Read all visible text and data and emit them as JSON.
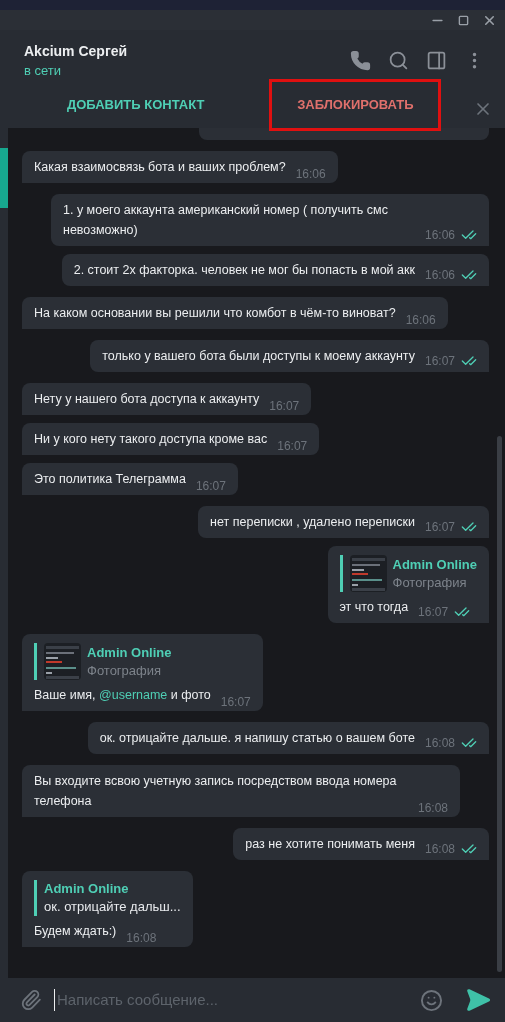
{
  "window": {
    "controls": [
      {
        "kind": "minimize"
      },
      {
        "kind": "maximize"
      },
      {
        "kind": "close"
      }
    ]
  },
  "header": {
    "name": "Akcium Сергей",
    "status": "в сети",
    "icons": [
      {
        "kind": "phone"
      },
      {
        "kind": "search"
      },
      {
        "kind": "sidebar"
      },
      {
        "kind": "menu"
      }
    ]
  },
  "action_bar": {
    "buttons": [
      {
        "label": "ДОБАВИТЬ КОНТАКТ",
        "kind": "add",
        "highlighted": false
      },
      {
        "label": "ЗАБЛОКИРОВАТЬ",
        "kind": "block",
        "highlighted": true
      }
    ]
  },
  "messages": [
    {
      "out": false,
      "kind": "text",
      "text": "Какая взаимосвязь бота и ваших проблем?",
      "time": "16:06"
    },
    {
      "out": true,
      "kind": "text",
      "text": "1. у моего аккаунта американский номер ( получить смс невозможно)",
      "time": "16:06",
      "read": true
    },
    {
      "out": true,
      "kind": "text",
      "text": "2. стоит 2х факторка. человек не мог бы попасть в мой акк",
      "time": "16:06",
      "read": true
    },
    {
      "out": false,
      "kind": "text",
      "text": "На каком основании вы решили что комбот в чём-то виноват?",
      "time": "16:06"
    },
    {
      "out": true,
      "kind": "text",
      "text": "только у вашего бота были доступы  к моему аккаунту",
      "time": "16:07",
      "read": true
    },
    {
      "out": false,
      "kind": "text",
      "text": "Нету у нашего бота доступа к аккаунту",
      "time": "16:07"
    },
    {
      "out": false,
      "kind": "text",
      "text": "Ни у кого нету такого доступа кроме вас",
      "time": "16:07"
    },
    {
      "out": false,
      "kind": "text",
      "text": "Это политика Телеграмма",
      "time": "16:07"
    },
    {
      "out": true,
      "kind": "text",
      "text": "нет переписки , удалено  переписки",
      "time": "16:07",
      "read": true
    },
    {
      "out": true,
      "kind": "reply",
      "reply": {
        "author": "Admin Online",
        "preview": "Фотография",
        "photo": true
      },
      "text": "эт что тогда",
      "time": "16:07",
      "read": true
    },
    {
      "out": false,
      "kind": "reply",
      "reply": {
        "author": "Admin Online",
        "preview": "Фотография",
        "photo": true
      },
      "parts": [
        {
          "text": "Ваше имя, ",
          "kind": "plain"
        },
        {
          "text": "@username",
          "kind": "mention"
        },
        {
          "text": " и фото",
          "kind": "plain"
        }
      ],
      "time": "16:07"
    },
    {
      "out": true,
      "kind": "text",
      "text": "ок. отрицайте дальше. я напишу статью о вашем боте",
      "time": "16:08",
      "read": true
    },
    {
      "out": false,
      "kind": "text",
      "text": "Вы входите всвою учетную запись посредством ввода номера телефона",
      "time": "16:08"
    },
    {
      "out": true,
      "kind": "text",
      "text": "раз не хотите понимать меня",
      "time": "16:08",
      "read": true
    },
    {
      "out": false,
      "kind": "reply",
      "reply": {
        "author": "Admin Online",
        "preview": "ок. отрицайте дальш...",
        "photo": false
      },
      "text": "Будем ждать:)",
      "time": "16:08"
    }
  ],
  "composer": {
    "placeholder": "Написать сообщение..."
  }
}
